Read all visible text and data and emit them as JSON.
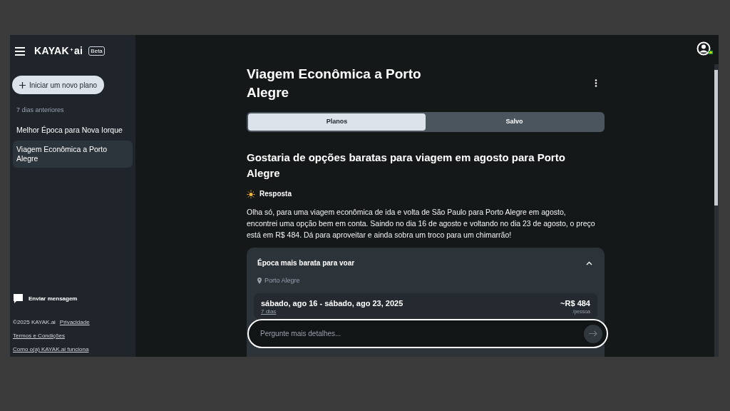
{
  "sidebar": {
    "brand": "KAYAK",
    "brand_suffix": "ai",
    "badge": "Beta",
    "new_plan_button": "Iniciar um novo plano",
    "section_label": "7 dias anteriores",
    "items": [
      {
        "label": "Melhor Época para Nova Iorque",
        "selected": false
      },
      {
        "label": "Viagem Econômica a Porto Alegre",
        "selected": true
      }
    ],
    "feedback": "Enviar mensagem",
    "copyright": "©2025 KAYAK.ai",
    "links": [
      "Privacidade",
      "Termos e Condições",
      "Como o(a) KAYAK.ai funciona"
    ]
  },
  "main": {
    "title": "Viagem Econômica a Porto Alegre",
    "tabs": [
      {
        "label": "Planos",
        "selected": true
      },
      {
        "label": "Salvo",
        "selected": false
      }
    ],
    "question": "Gostaria de opções baratas para viagem em agosto para Porto Alegre",
    "answer_label": "Resposta",
    "answer": "Olha só, para uma viagem econômica de ida e volta de São Paulo para Porto Alegre em agosto, encontrei uma opção bem em conta. Saindo no dia 16 de agosto e voltando no dia 23 de agosto, o preço está em R$ 484. Dá para aproveitar e ainda sobra um troco para um chimarrão!",
    "card": {
      "title": "Época mais barata para voar",
      "expanded": true,
      "location": "Porto Alegre",
      "trip": {
        "dates": "sábado, ago 16 - sábado, ago 23, 2025",
        "duration": "7 dias",
        "price": "~R$ 484",
        "unit": "/pessoa"
      }
    },
    "input": {
      "placeholder": "Pergunte mais detalhes..."
    }
  }
}
